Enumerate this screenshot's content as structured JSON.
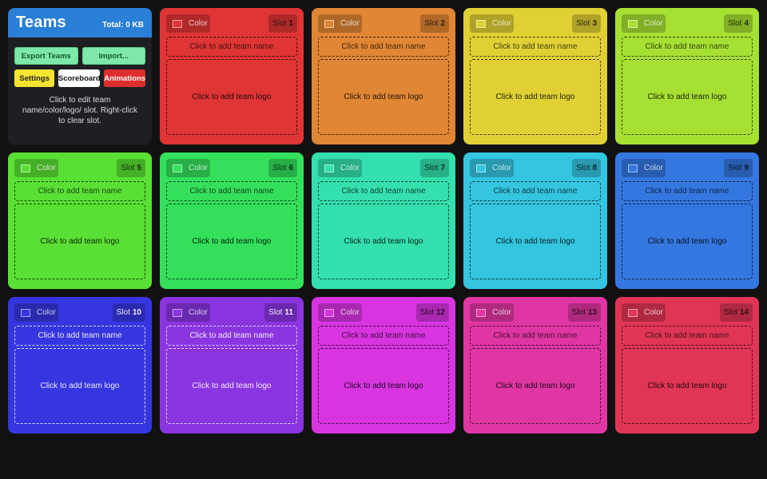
{
  "panel": {
    "title": "Teams",
    "total": "Total: 0 KB",
    "buttons": {
      "export": "Export Teams",
      "import": "Import...",
      "settings": "Settings",
      "scoreboard": "Scoreboard",
      "animations": "Animations"
    },
    "help_text": "Click to edit team name/color/logo/ slot. Right-click to clear slot."
  },
  "card_labels": {
    "color": "Color",
    "slot_prefix": "Slot",
    "name_placeholder": "Click to add team name",
    "logo_placeholder": "Click to add team logo"
  },
  "teams": [
    {
      "slot": "1",
      "bg": "#e03535",
      "swatch": "#e03535"
    },
    {
      "slot": "2",
      "bg": "#e08634",
      "swatch": "#e08634"
    },
    {
      "slot": "3",
      "bg": "#e0d034",
      "swatch": "#e0d034"
    },
    {
      "slot": "4",
      "bg": "#a6e033",
      "swatch": "#a6e033"
    },
    {
      "slot": "5",
      "bg": "#5ae034",
      "swatch": "#5ae034"
    },
    {
      "slot": "6",
      "bg": "#34e05b",
      "swatch": "#34e05b"
    },
    {
      "slot": "7",
      "bg": "#34e0ad",
      "swatch": "#34e0ad"
    },
    {
      "slot": "8",
      "bg": "#34c5e0",
      "swatch": "#34c5e0"
    },
    {
      "slot": "9",
      "bg": "#3477e0",
      "swatch": "#3477e0"
    },
    {
      "slot": "10",
      "bg": "#3636e0",
      "swatch": "#3636e0"
    },
    {
      "slot": "11",
      "bg": "#8a35e0",
      "swatch": "#8a35e0"
    },
    {
      "slot": "12",
      "bg": "#d835e0",
      "swatch": "#d835e0"
    },
    {
      "slot": "13",
      "bg": "#e036a3",
      "swatch": "#e036a3"
    },
    {
      "slot": "14",
      "bg": "#e03554",
      "swatch": "#e03554"
    }
  ]
}
